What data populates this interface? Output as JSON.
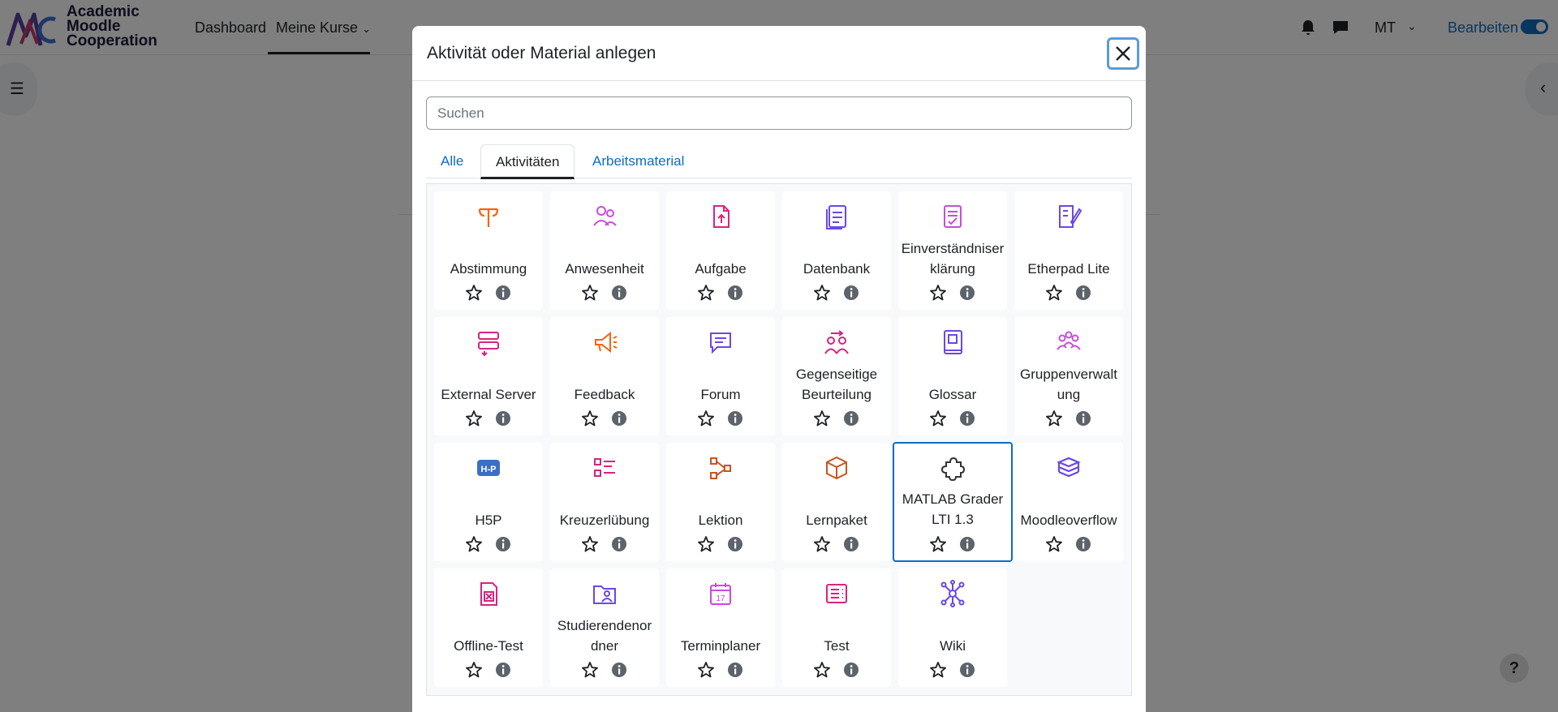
{
  "navbar": {
    "logo_lines": [
      "Academic",
      "Moodle",
      "Cooperation"
    ],
    "dashboard": "Dashboard",
    "meine_kurse": "Meine Kurse",
    "user_initials": "MT",
    "edit_mode_label": "Bearbeiten"
  },
  "help_label": "?",
  "modal": {
    "title": "Aktivität oder Material anlegen",
    "search_placeholder": "Suchen",
    "tabs": [
      "Alle",
      "Aktivitäten",
      "Arbeitsmaterial"
    ],
    "active_tab": "Aktivitäten",
    "items": [
      {
        "label": "Abstimmung",
        "icon": "choice-icon",
        "color": "#f7630c"
      },
      {
        "label": "Anwesenheit",
        "icon": "attendance-icon",
        "color": "#c74ddb"
      },
      {
        "label": "Aufgabe",
        "icon": "assignment-icon",
        "color": "#d6247f"
      },
      {
        "label": "Datenbank",
        "icon": "database-icon",
        "color": "#6c48e0"
      },
      {
        "label": "Einverständniserklärung",
        "label_lines": [
          "Einverständniser",
          "klärung"
        ],
        "icon": "agreement-icon",
        "color": "#c74ddb"
      },
      {
        "label": "Etherpad Lite",
        "icon": "etherpad-icon",
        "color": "#6c48e0"
      },
      {
        "label": "External Server",
        "icon": "external-server-icon",
        "color": "#d6247f"
      },
      {
        "label": "Feedback",
        "icon": "feedback-icon",
        "color": "#f7630c"
      },
      {
        "label": "Forum",
        "icon": "forum-icon",
        "color": "#6c48e0"
      },
      {
        "label": "Gegenseitige Beurteilung",
        "label_lines": [
          "Gegenseitige",
          "Beurteilung"
        ],
        "icon": "workshop-icon",
        "color": "#d6247f"
      },
      {
        "label": "Glossar",
        "icon": "glossary-icon",
        "color": "#6c48e0"
      },
      {
        "label": "Gruppenverwaltung",
        "label_lines": [
          "Gruppenverwalt",
          "ung"
        ],
        "icon": "group-icon",
        "color": "#c74ddb"
      },
      {
        "label": "H5P",
        "icon": "h5p-icon",
        "color": "#3b6fc7"
      },
      {
        "label": "Kreuzerlübung",
        "icon": "checklist-icon",
        "color": "#d6247f"
      },
      {
        "label": "Lektion",
        "icon": "lesson-icon",
        "color": "#c8541e"
      },
      {
        "label": "Lernpaket",
        "icon": "package-icon",
        "color": "#c8541e"
      },
      {
        "label": "MATLAB Grader LTI 1.3",
        "label_lines": [
          "MATLAB Grader",
          "LTI 1.3"
        ],
        "icon": "puzzle-icon",
        "color": "#333333",
        "selected": true
      },
      {
        "label": "Moodleoverflow",
        "icon": "stack-icon",
        "color": "#6c48e0"
      },
      {
        "label": "Offline-Test",
        "icon": "offline-quiz-icon",
        "color": "#d6247f"
      },
      {
        "label": "Studierendenordner",
        "label_lines": [
          "Studierendenor",
          "dner"
        ],
        "icon": "student-folder-icon",
        "color": "#6c48e0"
      },
      {
        "label": "Terminplaner",
        "icon": "calendar-icon",
        "color": "#c74ddb"
      },
      {
        "label": "Test",
        "icon": "quiz-icon",
        "color": "#d6247f"
      },
      {
        "label": "Wiki",
        "icon": "wiki-icon",
        "color": "#6c48e0"
      }
    ]
  },
  "colors": {
    "accent": "#0f6cbf",
    "text": "#1d2125"
  }
}
